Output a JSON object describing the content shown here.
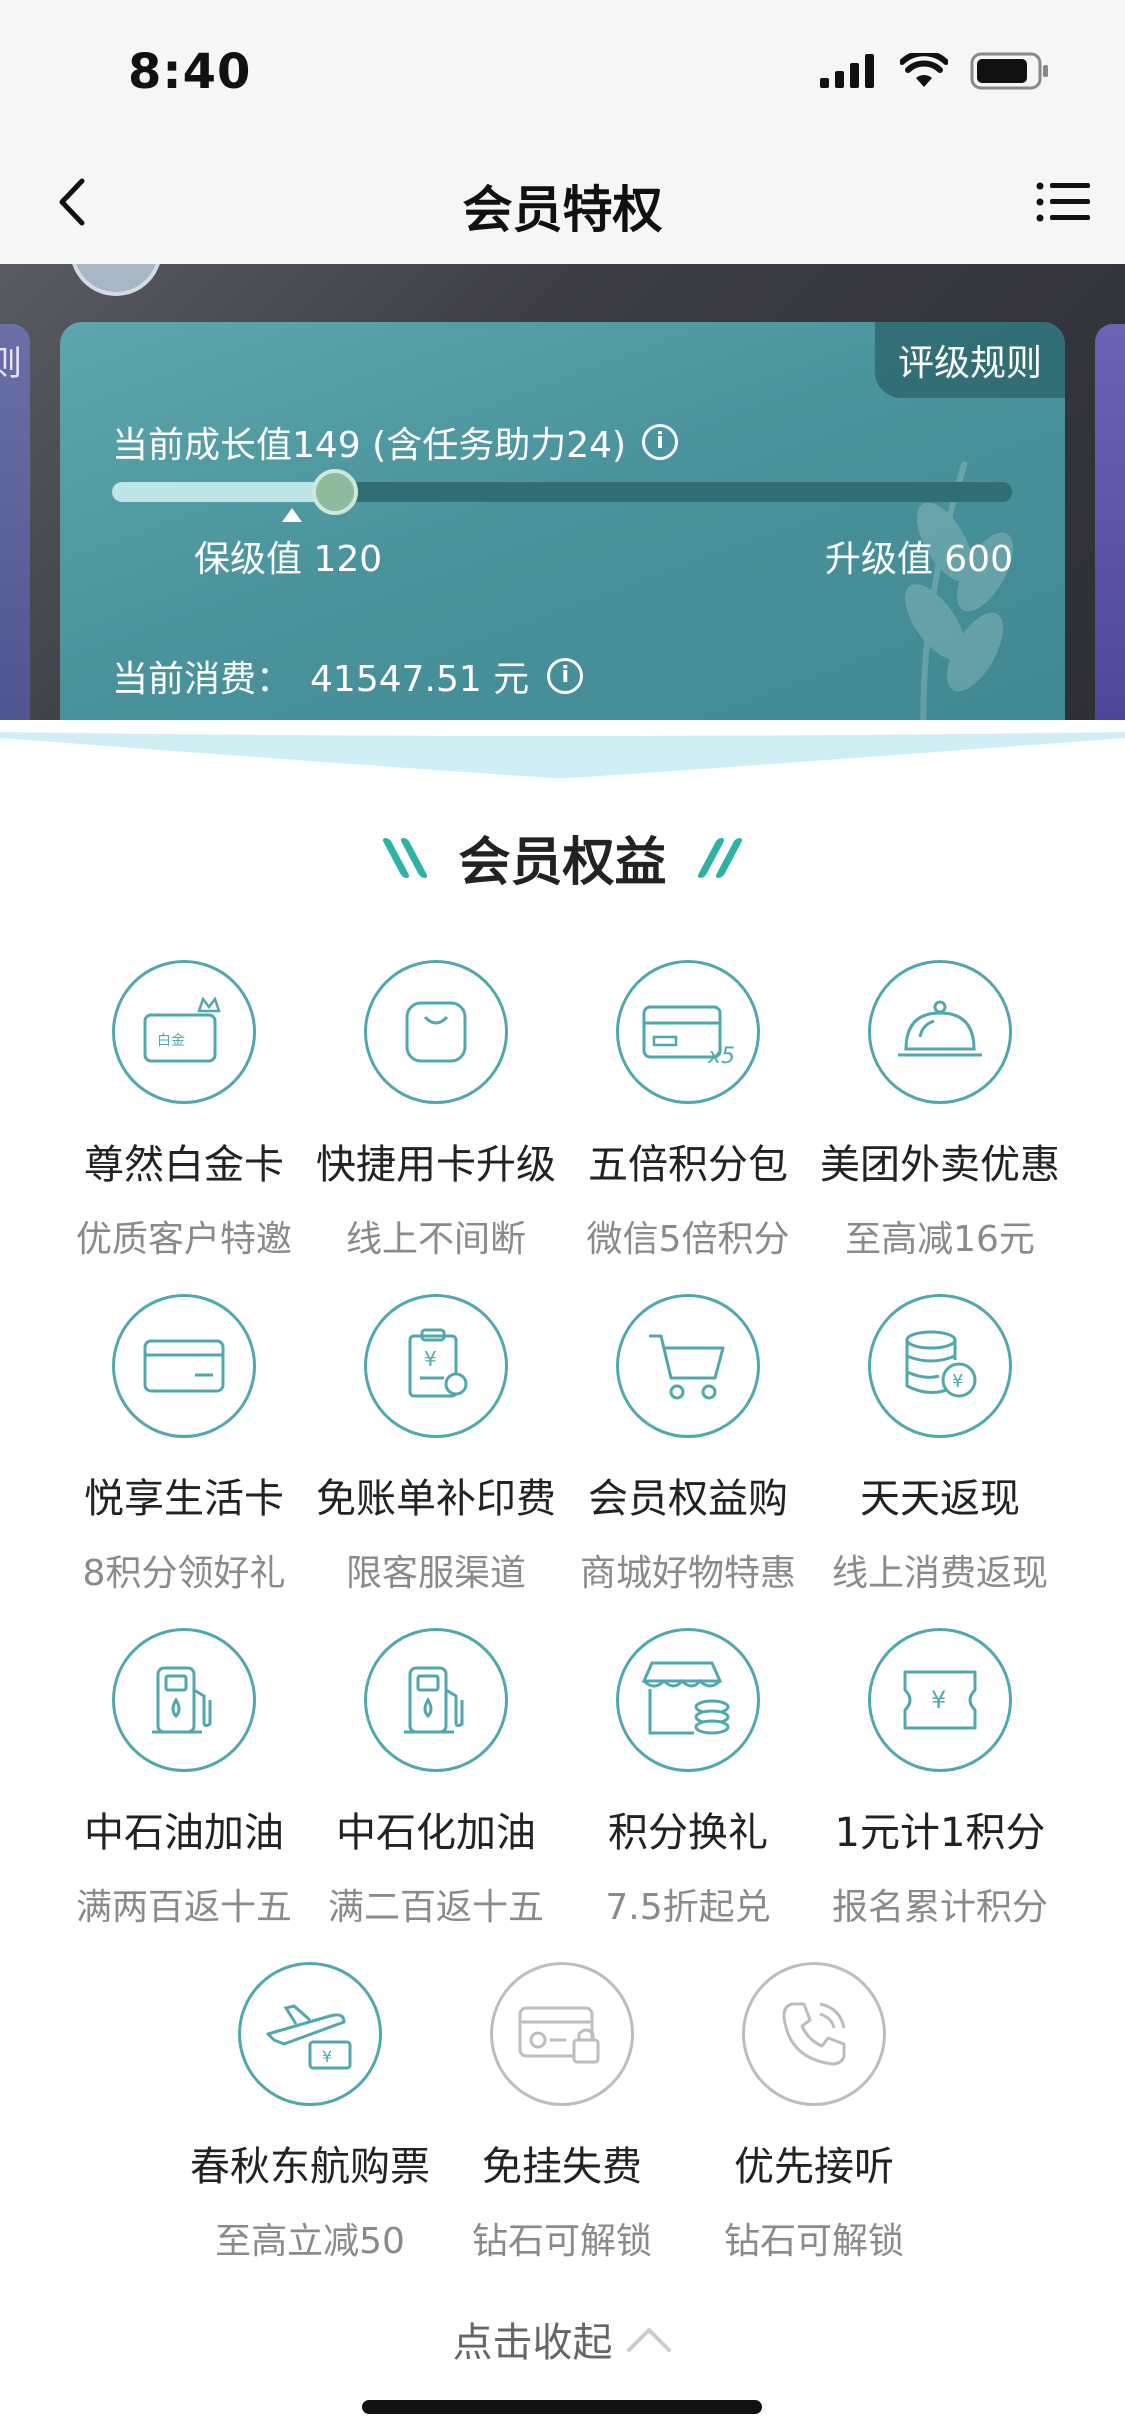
{
  "status_bar": {
    "time": "8:40"
  },
  "nav": {
    "title": "会员特权"
  },
  "left_side_card_text": "则",
  "card": {
    "rule_button": "评级规则",
    "growth_text": "当前成长值149 (含任务助力24)",
    "progress_fraction": 0.248,
    "keep_marker_fraction": 0.2,
    "keep_label": "保级值 120",
    "upgrade_label": "升级值 600",
    "spend_label": "当前消费：",
    "spend_value": "41547.51 元"
  },
  "section_title": "会员权益",
  "benefits": [
    {
      "name": "尊然白金卡",
      "desc": "优质客户特邀",
      "icon": "platinum-card-icon",
      "card_text": "白金"
    },
    {
      "name": "快捷用卡升级",
      "desc": "线上不间断",
      "icon": "quick-card-icon"
    },
    {
      "name": "五倍积分包",
      "desc": "微信5倍积分",
      "icon": "five-times-points-icon",
      "badge": "x5"
    },
    {
      "name": "美团外卖优惠",
      "desc": "至高减16元",
      "icon": "food-cloche-icon"
    },
    {
      "name": "悦享生活卡",
      "desc": "8积分领好礼",
      "icon": "life-card-icon"
    },
    {
      "name": "免账单补印费",
      "desc": "限客服渠道",
      "icon": "bill-reprint-icon"
    },
    {
      "name": "会员权益购",
      "desc": "商城好物特惠",
      "icon": "shopping-cart-icon"
    },
    {
      "name": "天天返现",
      "desc": "线上消费返现",
      "icon": "cashback-coins-icon"
    },
    {
      "name": "中石油加油",
      "desc": "满两百返十五",
      "icon": "petrochina-fuel-icon"
    },
    {
      "name": "中石化加油",
      "desc": "满二百返十五",
      "icon": "sinopec-fuel-icon"
    },
    {
      "name": "积分换礼",
      "desc": "7.5折起兑",
      "icon": "points-store-icon"
    },
    {
      "name": "1元计1积分",
      "desc": "报名累计积分",
      "icon": "yuan-ticket-icon"
    },
    {
      "name": "春秋东航购票",
      "desc": "至高立减50",
      "icon": "airplane-ticket-icon"
    },
    {
      "name": "免挂失费",
      "desc": "钻石可解锁",
      "icon": "card-lock-icon",
      "locked": true
    },
    {
      "name": "优先接听",
      "desc": "钻石可解锁",
      "icon": "phone-icon",
      "locked": true
    }
  ],
  "collapse_label": "点击收起",
  "colors": {
    "accent": "#52a7ad",
    "card": "#4b939c",
    "title_slash": "#2db3a3"
  }
}
